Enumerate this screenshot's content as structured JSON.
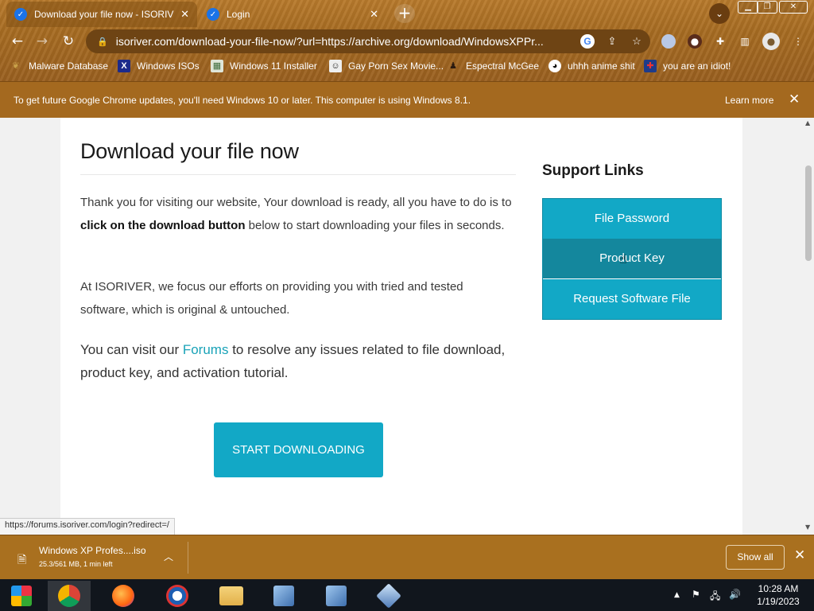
{
  "tabs": [
    {
      "title": "Download your file now - ISORIV",
      "active": true,
      "favicon": "blue-check-icon"
    },
    {
      "title": "Login",
      "active": false,
      "favicon": "blue-check-icon"
    }
  ],
  "toolbar": {
    "url": "isoriver.com/download-your-file-now/?url=https://archive.org/download/WindowsXPPr..."
  },
  "bookmarks": [
    {
      "label": "Malware Database",
      "icon": "leaf-icon"
    },
    {
      "label": "Windows ISOs",
      "icon": "x-logo-icon"
    },
    {
      "label": "Windows 11 Installer",
      "icon": "image-icon"
    },
    {
      "label": "Gay Porn Sex Movie...",
      "icon": "face-icon"
    },
    {
      "label": "Espectral McGee",
      "icon": "avatar-icon"
    },
    {
      "label": "uhhh anime shit",
      "icon": "anime-icon"
    },
    {
      "label": "you are an idiot!",
      "icon": "flag-icon"
    }
  ],
  "infobar": {
    "message": "To get future Google Chrome updates, you'll need Windows 10 or later. This computer is using Windows 8.1.",
    "learn_more": "Learn more"
  },
  "page": {
    "heading": "Download your file now",
    "para1_pre": "Thank you for visiting our website, Your download is ready, all you have to do is to ",
    "para1_bold": "click on the download button",
    "para1_post": " below to start downloading your files in seconds.",
    "para2": "At ISORIVER, we focus our efforts on providing you with tried and tested software, which is original & untouched.",
    "para3_pre": "You can visit our ",
    "para3_link": "Forums",
    "para3_post": " to resolve any issues related to file download, product key, and activation tutorial.",
    "download_button": "START DOWNLOADING",
    "support_title": "Support Links",
    "support_links": [
      "File Password",
      "Product Key",
      "Request Software File"
    ]
  },
  "status_url": "https://forums.isoriver.com/login?redirect=/",
  "download_shelf": {
    "file_name": "Windows XP Profes....iso",
    "status": "25.3/561 MB, 1 min left",
    "show_all": "Show all"
  },
  "taskbar": {
    "time": "10:28 AM",
    "date": "1/19/2023"
  },
  "colors": {
    "accent": "#12a8c6",
    "accent_hover": "#14879d",
    "frame": "#a76c22"
  }
}
